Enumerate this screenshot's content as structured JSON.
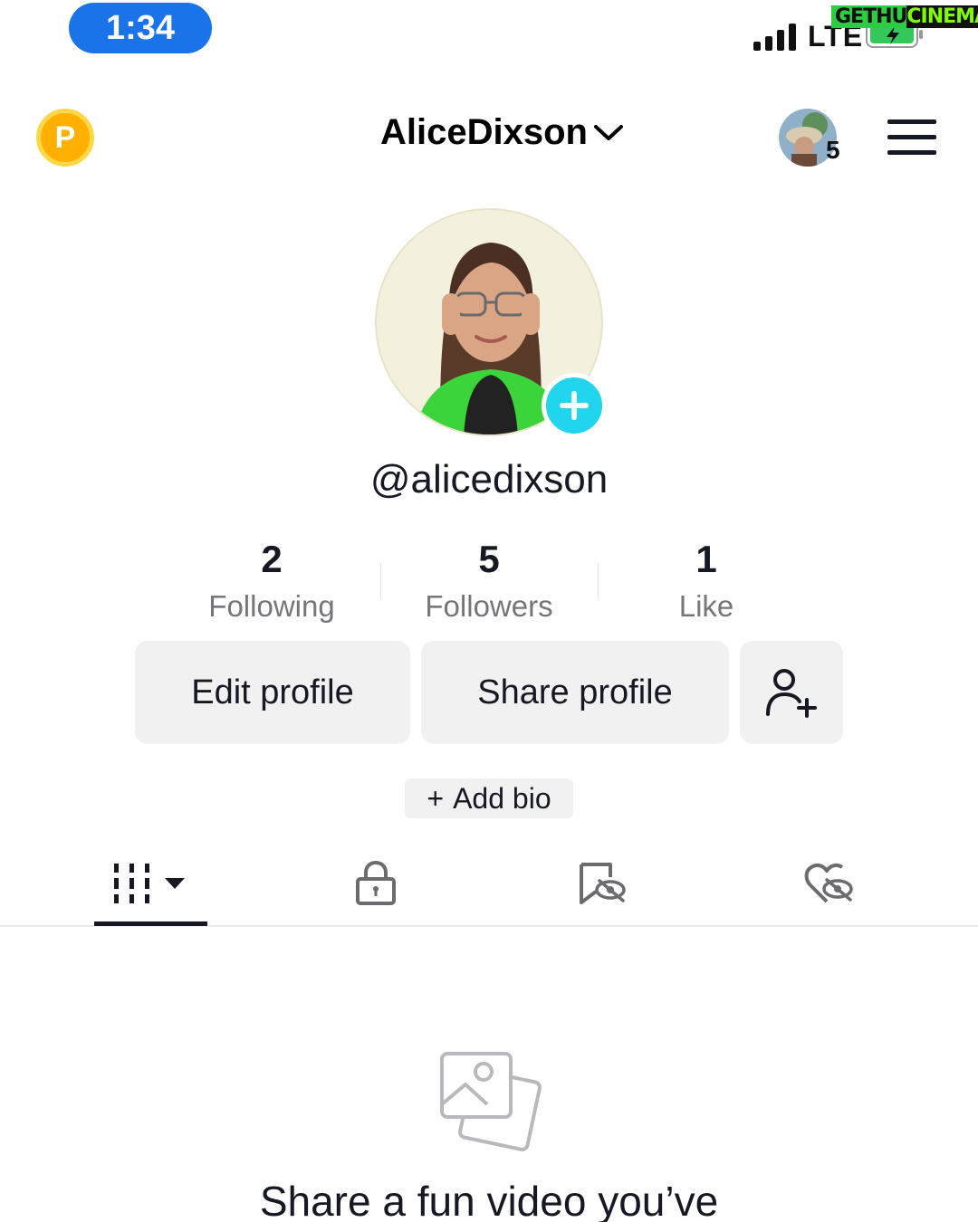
{
  "status_bar": {
    "time": "1:34",
    "network": "LTE",
    "watermark_left": "GETHU",
    "watermark_right": "CINEMA"
  },
  "header": {
    "coin_letter": "P",
    "username": "AliceDixson",
    "account_count": "5"
  },
  "profile": {
    "handle": "@alicedixson"
  },
  "stats": [
    {
      "value": "2",
      "label": "Following"
    },
    {
      "value": "5",
      "label": "Followers"
    },
    {
      "value": "1",
      "label": "Like"
    }
  ],
  "actions": {
    "edit_label": "Edit profile",
    "share_label": "Share profile",
    "add_bio_label": "Add bio",
    "add_bio_prefix": "+"
  },
  "tabs": [
    {
      "icon": "videos-grid-icon",
      "active": true
    },
    {
      "icon": "lock-icon",
      "active": false
    },
    {
      "icon": "reposts-hidden-icon",
      "active": false
    },
    {
      "icon": "liked-hidden-icon",
      "active": false
    }
  ],
  "empty_state": {
    "icon": "photos-icon",
    "text": "Share a fun video you’ve"
  },
  "colors": {
    "time_pill": "#1a73e8",
    "coin": "#ffb000",
    "add_avatar": "#20d5ec",
    "button_bg": "#f1f1f2",
    "secondary_text": "#75767c"
  }
}
